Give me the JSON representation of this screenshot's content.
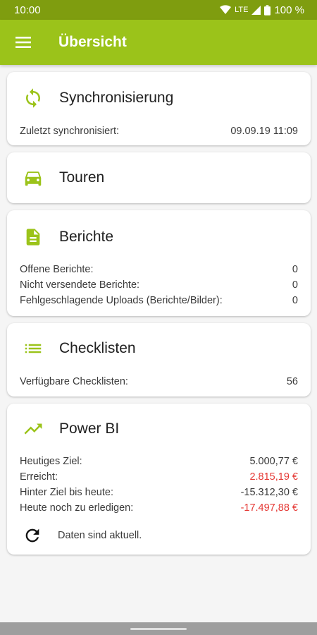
{
  "status_bar": {
    "time": "10:00",
    "network": "LTE",
    "battery": "100 %"
  },
  "app_bar": {
    "title": "Übersicht",
    "menu_icon": "menu-icon"
  },
  "cards": {
    "sync": {
      "title": "Synchronisierung",
      "icon": "sync-icon",
      "rows": [
        {
          "label": "Zuletzt synchronisiert:",
          "value": "09.09.19 11:09"
        }
      ]
    },
    "tours": {
      "title": "Touren",
      "icon": "car-icon"
    },
    "reports": {
      "title": "Berichte",
      "icon": "document-icon",
      "rows": [
        {
          "label": "Offene Berichte:",
          "value": "0"
        },
        {
          "label": "Nicht versendete Berichte:",
          "value": "0"
        },
        {
          "label": "Fehlgeschlagende Uploads (Berichte/Bilder):",
          "value": "0"
        }
      ]
    },
    "checklists": {
      "title": "Checklisten",
      "icon": "list-icon",
      "rows": [
        {
          "label": "Verfügbare Checklisten:",
          "value": "56"
        }
      ]
    },
    "powerbi": {
      "title": "Power BI",
      "icon": "trending-up-icon",
      "rows": [
        {
          "label": "Heutiges Ziel:",
          "value": "5.000,77 €"
        },
        {
          "label": "Erreicht:",
          "value": "2.815,19 €"
        },
        {
          "label": "Hinter Ziel bis heute:",
          "value": "-15.312,30 €"
        },
        {
          "label": "Heute noch zu erledigen:",
          "value": "-17.497,88 €"
        }
      ],
      "status_text": "Daten sind aktuell.",
      "status_icon": "refresh-icon"
    }
  },
  "colors": {
    "accent": "#9bc31a",
    "status_bar": "#7f9d0f",
    "negative": "#e53935"
  }
}
